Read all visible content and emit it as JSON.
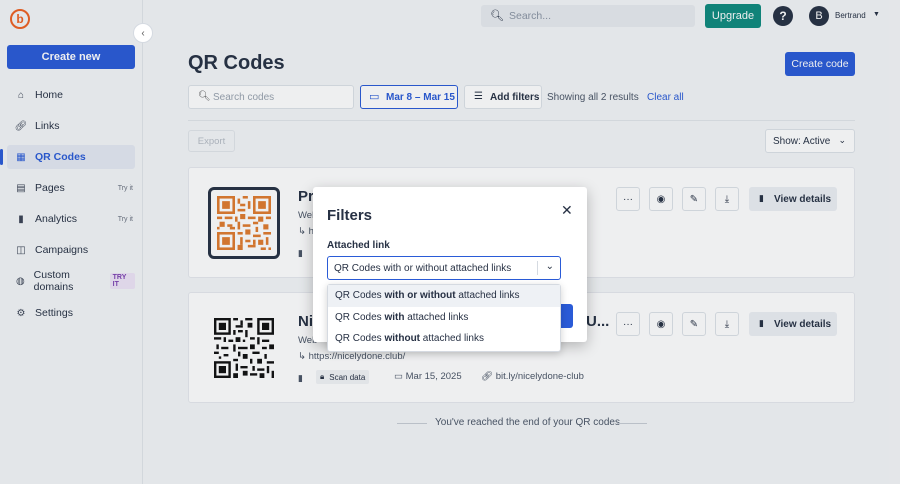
{
  "brand": {
    "logo_letter": "b",
    "accent": "#ee6123"
  },
  "sidebar": {
    "create_new": "Create new",
    "items": [
      {
        "label": "Home",
        "icon": "home-icon"
      },
      {
        "label": "Links",
        "icon": "link-icon"
      },
      {
        "label": "QR Codes",
        "icon": "qr-icon",
        "active": true
      },
      {
        "label": "Pages",
        "icon": "page-icon",
        "badge": "Try it"
      },
      {
        "label": "Analytics",
        "icon": "chart-icon",
        "badge": "Try it"
      },
      {
        "label": "Campaigns",
        "icon": "campaign-icon"
      },
      {
        "label": "Custom domains",
        "icon": "globe-icon",
        "badge": "TRY IT"
      },
      {
        "label": "Settings",
        "icon": "gear-icon"
      }
    ]
  },
  "topbar": {
    "search_placeholder": "Search...",
    "upgrade": "Upgrade",
    "help": "?",
    "avatar_letter": "B",
    "username": "Bertrand"
  },
  "main": {
    "title": "QR Codes",
    "create_code": "Create code",
    "search_placeholder": "Search codes",
    "date_range": "Mar 8 – Mar 15",
    "add_filters": "Add filters",
    "showing": "Showing all 2 results",
    "clear_all": "Clear all",
    "export": "Export",
    "show_filter": "Show: Active",
    "end_message": "You've reached the end of your QR codes"
  },
  "cards": [
    {
      "title": "Pr",
      "subtitle": "Web",
      "link": "h",
      "view_details": "View details"
    },
    {
      "title": "Ni",
      "title_tail": "U...",
      "subtitle": "Web",
      "link": "https://nicelydone.club/",
      "scan_data": "Scan data",
      "date": "Mar 15, 2025",
      "short_link": "bit.ly/nicelydone-club",
      "view_details": "View details"
    }
  ],
  "modal": {
    "title": "Filters",
    "label": "Attached link",
    "selected": "QR Codes with or without attached links",
    "options": [
      {
        "pre": "QR Codes ",
        "bold": "with or without",
        "post": " attached links"
      },
      {
        "pre": "QR Codes ",
        "bold": "with",
        "post": " attached links"
      },
      {
        "pre": "QR Codes ",
        "bold": "without",
        "post": " attached links"
      }
    ]
  },
  "colors": {
    "primary": "#2a5bd7",
    "upgrade": "#0f8a7e",
    "text": "#273144",
    "qr_orange": "#e07b2e"
  }
}
